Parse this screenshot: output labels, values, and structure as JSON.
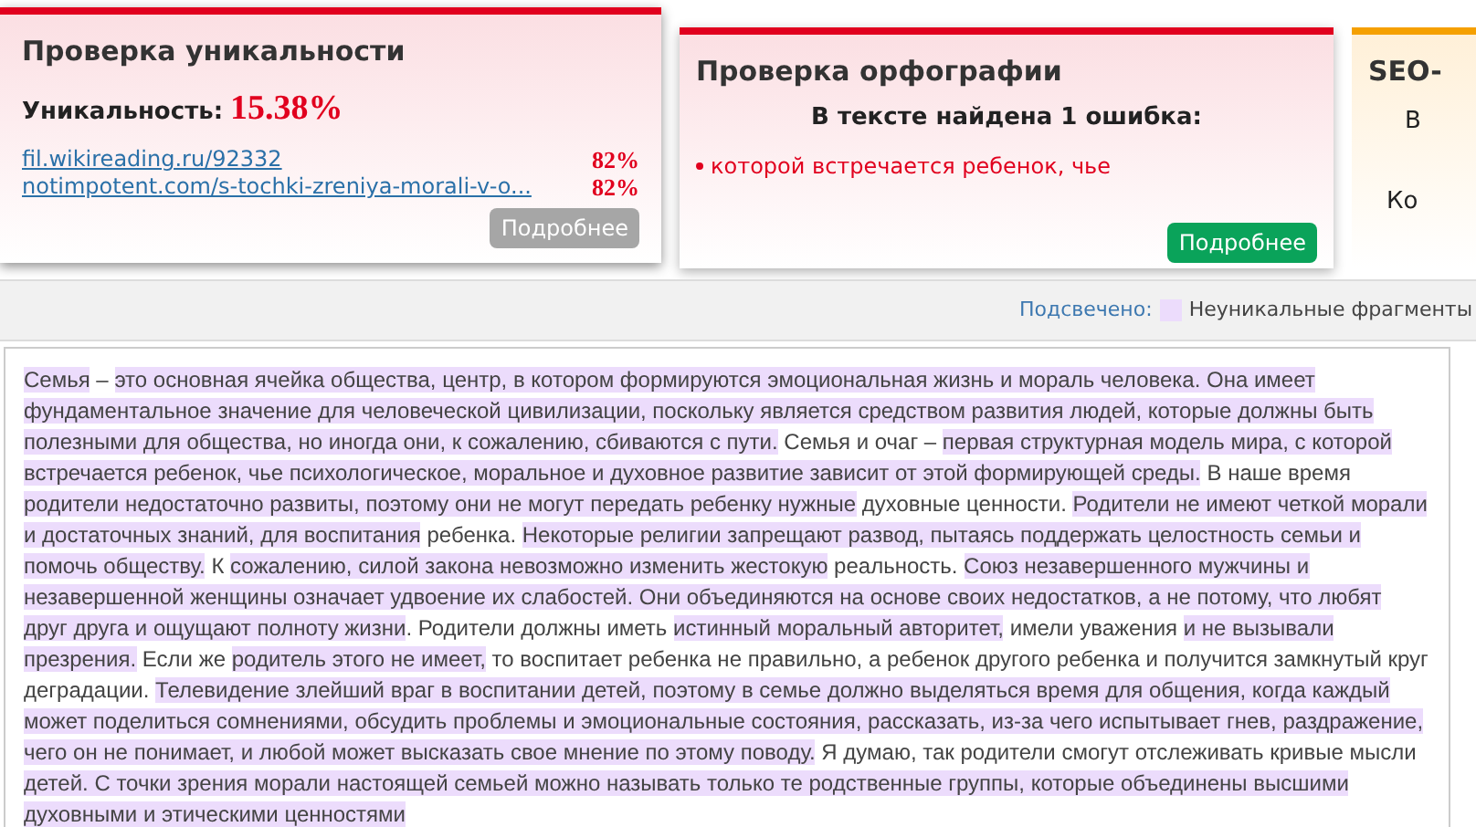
{
  "cards": [
    {
      "kind": "uniqueness",
      "title": "Проверка уникальности",
      "label": "Уникальность:",
      "value": "15.38%",
      "sources": [
        {
          "url": "fil.wikireading.ru/92332",
          "percent": "82%"
        },
        {
          "url": "notimpotent.com/s-tochki-zreniya-morali-v-o...",
          "percent": "82%"
        }
      ],
      "button": {
        "label": "Подробнее",
        "disabled": true
      }
    },
    {
      "kind": "spelling",
      "title": "Проверка орфографии",
      "summary": "В тексте найдена 1 ошибка:",
      "errors": [
        "которой встречается ребенок, чье"
      ],
      "button": {
        "label": "Подробнее",
        "disabled": false
      }
    },
    {
      "kind": "seo",
      "title": "SEO-",
      "lines": [
        "В",
        "Ко"
      ]
    }
  ],
  "legend": {
    "label": "Подсвечено:",
    "item": "Неуникальные фрагменты",
    "color": "#ecdcfc"
  },
  "text": [
    {
      "text": "Семья",
      "highlighted": true
    },
    {
      "text": " – ",
      "highlighted": false
    },
    {
      "text": "это основная ячейка общества, центр, в котором формируются эмоциональная жизнь и мораль человека. Она имеет фундаментальное значение для человеческой цивилизации, поскольку является средством развития людей, которые должны быть полезными для общества, но иногда они, к сожалению, сбиваются с пути.",
      "highlighted": true
    },
    {
      "text": " Семья и очаг – ",
      "highlighted": false
    },
    {
      "text": "первая структурная модель мира, с которой встречается ребенок, чье психологическое, моральное и духовное развитие зависит от этой формирующей среды.",
      "highlighted": true
    },
    {
      "text": " В наше время ",
      "highlighted": false
    },
    {
      "text": "родители недостаточно развиты, поэтому они не могут передать ребенку нужные",
      "highlighted": true
    },
    {
      "text": " духовные ценности. ",
      "highlighted": false
    },
    {
      "text": "Родители не имеют четкой морали и достаточных знаний, для воспитания",
      "highlighted": true
    },
    {
      "text": " ребенка. ",
      "highlighted": false
    },
    {
      "text": "Некоторые религии запрещают развод, пытаясь поддержать целостность семьи и помочь обществу.",
      "highlighted": true
    },
    {
      "text": " К ",
      "highlighted": false
    },
    {
      "text": "сожалению, силой закона невозможно изменить жестокую",
      "highlighted": true
    },
    {
      "text": " реальность. ",
      "highlighted": false
    },
    {
      "text": "Союз незавершенного мужчины и незавершенной женщины означает удвоение их слабостей. Они объединяются на основе своих недостатков, а не потому, что любят друг друга и ощущают полноту жизни",
      "highlighted": true
    },
    {
      "text": ". Родители должны иметь ",
      "highlighted": false
    },
    {
      "text": "истинный моральный авторитет,",
      "highlighted": true
    },
    {
      "text": " имели уважения ",
      "highlighted": false
    },
    {
      "text": "и не вызывали презрения.",
      "highlighted": true
    },
    {
      "text": " Если же ",
      "highlighted": false
    },
    {
      "text": "родитель этого не имеет,",
      "highlighted": true
    },
    {
      "text": " то воспитает ребенка не правильно, а ребенок другого ребенка и получится замкнутый круг деградации. ",
      "highlighted": false
    },
    {
      "text": "Телевидение злейший враг в воспитании детей, поэтому в семье должно выделяться время для общения, когда каждый может поделиться сомнениями, обсудить проблемы и эмоциональные состояния, рассказать, из-за чего испытывает гнев, раздражение, чего он не понимает, и любой может высказать свое мнение по этому поводу.",
      "highlighted": true
    },
    {
      "text": " Я думаю, так родители смогут отслеживать кривые мысли ",
      "highlighted": false
    },
    {
      "text": "детей.",
      "highlighted": true
    },
    {
      "text": " С точки зрения морали настоящей семьей можно называть только те родственные группы, которые объединены высшими духовными и этическими ценностями",
      "highlighted": true
    }
  ]
}
